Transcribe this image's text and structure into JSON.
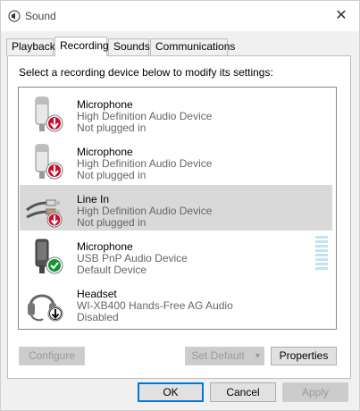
{
  "window": {
    "title": "Sound",
    "close_glyph": "✕"
  },
  "tabs": [
    {
      "label": "Playback",
      "active": false
    },
    {
      "label": "Recording",
      "active": true
    },
    {
      "label": "Sounds",
      "active": false
    },
    {
      "label": "Communications",
      "active": false
    }
  ],
  "instruction": "Select a recording device below to modify its settings:",
  "devices": [
    {
      "name": "Microphone",
      "description": "High Definition Audio Device",
      "status": "Not plugged in",
      "icon": "microphone-icon",
      "badge": "down-arrow-red-badge",
      "selected": false
    },
    {
      "name": "Microphone",
      "description": "High Definition Audio Device",
      "status": "Not plugged in",
      "icon": "microphone-icon",
      "badge": "down-arrow-red-badge",
      "selected": false
    },
    {
      "name": "Line In",
      "description": "High Definition Audio Device",
      "status": "Not plugged in",
      "icon": "line-in-cable-icon",
      "badge": "down-arrow-red-badge",
      "selected": true
    },
    {
      "name": "Microphone",
      "description": "USB PnP Audio Device",
      "status": "Default Device",
      "icon": "microphone-icon",
      "badge": "green-check-badge",
      "selected": false
    },
    {
      "name": "Headset",
      "description": "WI-XB400 Hands-Free AG Audio",
      "status": "Disabled",
      "icon": "headset-icon",
      "badge": "down-arrow-black-badge",
      "selected": false
    }
  ],
  "buttons": {
    "configure": "Configure",
    "set_default": "Set Default",
    "set_default_arrow": "▼",
    "properties": "Properties",
    "ok": "OK",
    "cancel": "Cancel",
    "apply": "Apply"
  },
  "colors": {
    "selection": "#d9d9d9",
    "default_button_border": "#0078d7",
    "level_meter": "#bfe3f0"
  }
}
